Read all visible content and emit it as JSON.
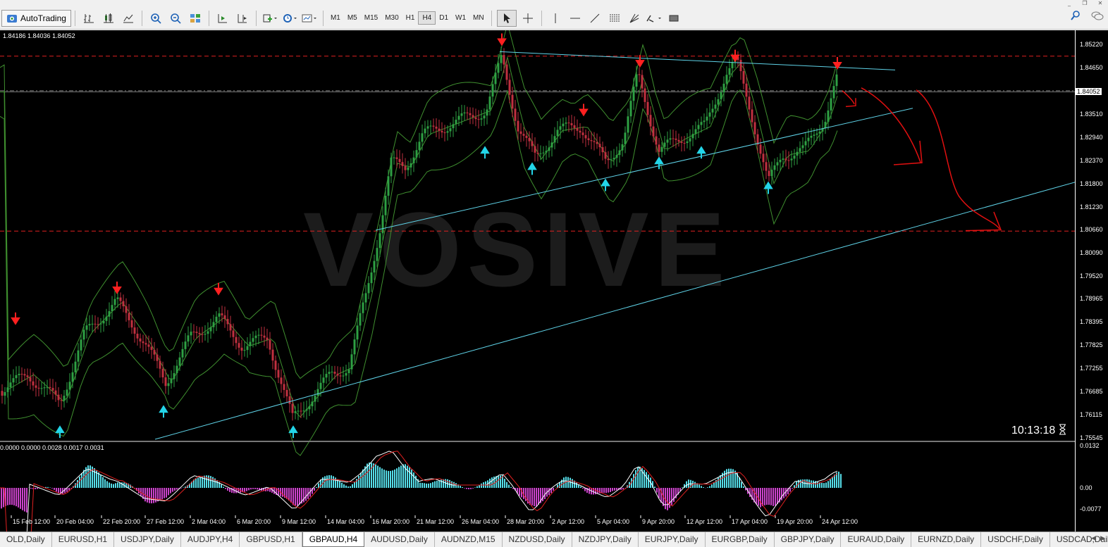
{
  "window": {
    "min": "_",
    "restore": "❐",
    "close": "✕"
  },
  "toolbar": {
    "autotrading": "AutoTrading",
    "timeframes": [
      "M1",
      "M5",
      "M15",
      "M30",
      "H1",
      "H4",
      "D1",
      "W1",
      "MN"
    ],
    "active_timeframe": "H4"
  },
  "chart": {
    "quote_line": "1.84186 1.84036 1.84052",
    "watermark": "VOSIVE",
    "clock": "10:13:18",
    "current_price": "1.84052",
    "price_axis": [
      "1.85220",
      "1.84650",
      "1.84052",
      "1.83510",
      "1.82940",
      "1.82370",
      "1.81800",
      "1.81230",
      "1.80660",
      "1.80090",
      "1.79520",
      "1.78965",
      "1.78395",
      "1.77825",
      "1.77255",
      "1.76685",
      "1.76115",
      "1.75545"
    ],
    "indicator_values": "0.0000 0.0000 0.0028 0.0017 0.0031",
    "indicator_axis": [
      "0.0132",
      "0.00",
      "-0.0077"
    ],
    "dates": [
      "15 Feb 12:00",
      "20 Feb 04:00",
      "22 Feb 20:00",
      "27 Feb 12:00",
      "2 Mar 04:00",
      "6 Mar 20:00",
      "9 Mar 12:00",
      "14 Mar 04:00",
      "16 Mar 20:00",
      "21 Mar 12:00",
      "26 Mar 04:00",
      "28 Mar 20:00",
      "2 Apr 12:00",
      "5 Apr 04:00",
      "9 Apr 20:00",
      "12 Apr 12:00",
      "17 Apr 04:00",
      "19 Apr 20:00",
      "24 Apr 12:00"
    ],
    "colors": {
      "bull": "#2ea043",
      "bear": "#c0303f",
      "band": "#3f8f2f",
      "trend": "#5fd3e8",
      "resist": "#e02020",
      "arrow_up": "#23d5e8",
      "arrow_down": "#ff2020",
      "macd_bar": "#cc44cc",
      "macd_bar_pos": "#55dde8"
    }
  },
  "tabs": [
    "OLD,Daily",
    "EURUSD,H1",
    "USDJPY,Daily",
    "AUDJPY,H4",
    "GBPUSD,H1",
    "GBPAUD,H4",
    "AUDUSD,Daily",
    "AUDNZD,M15",
    "NZDUSD,Daily",
    "NZDJPY,Daily",
    "EURJPY,Daily",
    "EURGBP,Daily",
    "GBPJPY,Daily",
    "EURAUD,Daily",
    "EURNZD,Daily",
    "USDCHF,Daily",
    "USDCAD,Daily"
  ],
  "active_tab": "GBPAUD,H4"
}
